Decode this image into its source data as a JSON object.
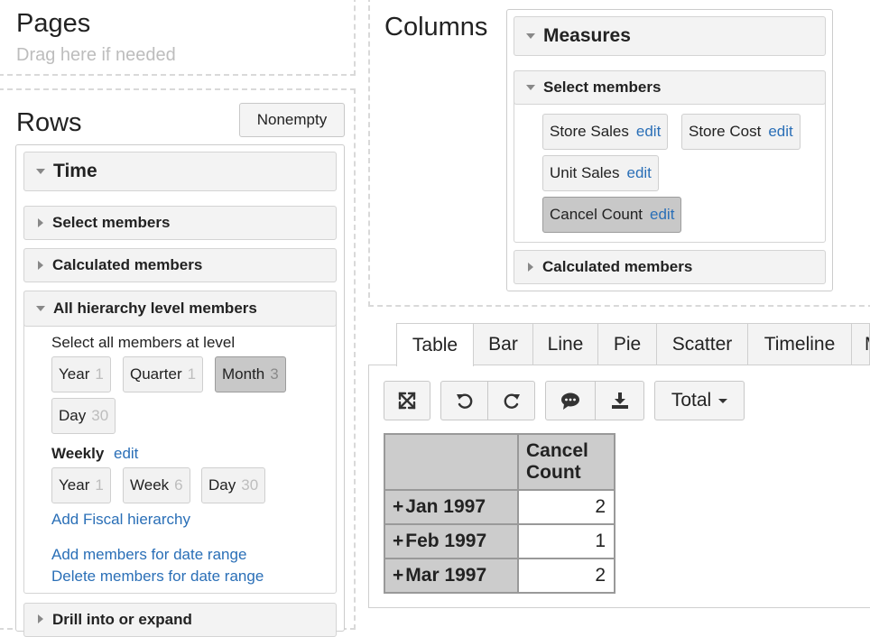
{
  "pages": {
    "title": "Pages",
    "hint": "Drag here if needed"
  },
  "rows": {
    "title": "Rows",
    "nonempty_label": "Nonempty",
    "dimension": "Time",
    "select_members": "Select members",
    "calculated_members": "Calculated members",
    "all_hierarchy": "All hierarchy level members",
    "select_all_label": "Select all members at level",
    "levels": [
      {
        "label": "Year",
        "count": "1"
      },
      {
        "label": "Quarter",
        "count": "1"
      },
      {
        "label": "Month",
        "count": "3",
        "selected": true
      },
      {
        "label": "Day",
        "count": "30"
      }
    ],
    "weekly_label": "Weekly",
    "weekly_edit": "edit",
    "weekly_levels": [
      {
        "label": "Year",
        "count": "1"
      },
      {
        "label": "Week",
        "count": "6"
      },
      {
        "label": "Day",
        "count": "30"
      }
    ],
    "add_fiscal": "Add Fiscal hierarchy",
    "add_range": "Add members for date range",
    "delete_range": "Delete members for date range",
    "drill": "Drill into or expand"
  },
  "columns": {
    "title": "Columns",
    "dimension": "Measures",
    "select_members": "Select members",
    "members": [
      {
        "label": "Store Sales",
        "edit": "edit"
      },
      {
        "label": "Store Cost",
        "edit": "edit"
      },
      {
        "label": "Unit Sales",
        "edit": "edit"
      },
      {
        "label": "Cancel Count",
        "edit": "edit",
        "selected": true
      }
    ],
    "calculated_members": "Calculated members"
  },
  "tabs": [
    "Table",
    "Bar",
    "Line",
    "Pie",
    "Scatter",
    "Timeline",
    "M"
  ],
  "toolbar": {
    "total_label": "Total"
  },
  "result": {
    "header": [
      "Cancel",
      "Count"
    ],
    "rows": [
      {
        "label": "Jan 1997",
        "value": "2"
      },
      {
        "label": "Feb 1997",
        "value": "1"
      },
      {
        "label": "Mar 1997",
        "value": "2"
      }
    ]
  }
}
